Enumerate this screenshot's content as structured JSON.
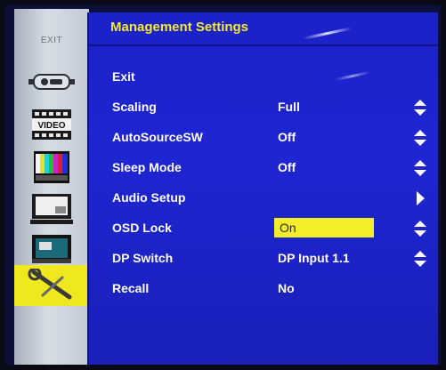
{
  "sidebar": {
    "exit_label": "EXIT",
    "video_label": "VIDEO",
    "items": [
      {
        "icon": "input-connector-icon"
      },
      {
        "icon": "video-icon"
      },
      {
        "icon": "color-bars-icon"
      },
      {
        "icon": "monitor-display-icon"
      },
      {
        "icon": "picture-in-picture-icon"
      },
      {
        "icon": "wrench-tools-icon",
        "active": true
      }
    ]
  },
  "menu": {
    "title": "Management Settings",
    "rows": [
      {
        "label": "Exit",
        "value": "",
        "control": "none"
      },
      {
        "label": "Scaling",
        "value": "Full",
        "control": "up-down"
      },
      {
        "label": "AutoSourceSW",
        "value": "Off",
        "control": "up-down"
      },
      {
        "label": "Sleep Mode",
        "value": "Off",
        "control": "up-down"
      },
      {
        "label": "Audio Setup",
        "value": "",
        "control": "right"
      },
      {
        "label": "OSD Lock",
        "value": "On",
        "control": "up-down",
        "selected": true
      },
      {
        "label": "DP Switch",
        "value": "DP Input 1.1",
        "control": "up-down"
      },
      {
        "label": "Recall",
        "value": "No",
        "control": "none"
      }
    ]
  },
  "colors": {
    "panel_blue": "#1e25d2",
    "title_yellow": "#f4ea2a",
    "highlight_yellow": "#f4ee2a",
    "sidebar_active": "#f0e81e"
  }
}
